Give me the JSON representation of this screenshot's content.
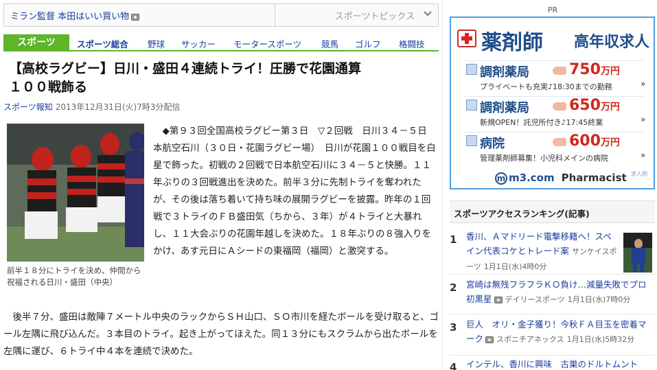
{
  "topbar": {
    "ticker": "ミラン監督 本田はいい買い物",
    "topics_label": "スポーツトピックス"
  },
  "nav": {
    "brand": "スポーツ",
    "items": [
      "スポーツ総合",
      "野球",
      "サッカー",
      "モータースポーツ",
      "競馬",
      "ゴルフ",
      "格闘技"
    ]
  },
  "article": {
    "headline_line1": "【高校ラグビー】日川・盛田４連続トライ！圧勝で花園通算",
    "headline_line2": "１００戦飾る",
    "source": "スポーツ報知",
    "date": "2013年12月31日(火)7時3分配信",
    "photo_caption": "前半１８分にトライを決め、仲間から祝福される日川・盛田（中央）",
    "lead": "◆第９３回全国高校ラグビー第３日　▽２回戦　日川３４－５日本航空石川（３０日・花園ラグビー場）　日川が花園１００戦目を白星で飾った。初戦の２回戦で日本航空石川に３４－５と快勝。１１年ぶりの３回戦進出を決めた。前半３分に先制トライを奪われたが、その後は落ち着いて持ち味の展開ラグビーを披露。昨年の１回戦で３トライのＦＢ盛田気（ちから、３年）が４トライと大暴れし、１１大会ぶりの花園年越しを決めた。１８年ぶりの８強入りをかけ、あす元日にＡシードの東福岡（福岡）と激突する。",
    "body": "後半７分、盛田は敵陣７メートル中央のラックからＳＨ山口、ＳＯ市川を経たボールを受け取ると、ゴール左隅に飛び込んだ。３本目のトライ。起き上がってほえた。同１３分にもスクラムから出たボールを左隅に運び、６トライ中４本を連続で決めた。"
  },
  "ad": {
    "pr": "PR",
    "title": "薬剤師",
    "title2": "高年収求人",
    "offers": [
      {
        "kind": "調剤薬局",
        "pay": "750",
        "unit": "万円",
        "note": "プライベートも充実♪18:30までの勤務",
        "more": "»"
      },
      {
        "kind": "調剤薬局",
        "pay": "650",
        "unit": "万円",
        "note": "新規OPEN！託児所付き♪17:45終業",
        "more": "»"
      },
      {
        "kind": "病院",
        "pay": "600",
        "unit": "万円",
        "note": "管理薬剤師募集！小児科メインの病院",
        "more": "»"
      }
    ],
    "logo": "m3.com",
    "logo_sub": "Pharmacist",
    "small": "求人例"
  },
  "ranking": {
    "title": "スポーツアクセスランキング(記事)",
    "items": [
      {
        "no": "1",
        "title": "香川、Ａマドリード電撃移籍へ！スペイン代表コケとトレード案",
        "source": "サンケイスポーツ",
        "date": "1月1日(水)4時0分"
      },
      {
        "no": "2",
        "title": "宮崎は無残フラフラＫＯ負け…減量失敗でプロ初黒星",
        "source": "デイリースポーツ",
        "date": "1月1日(水)7時0分"
      },
      {
        "no": "3",
        "title": "巨人　オリ・金子獲り！今秋ＦＡ目玉を密着マーク",
        "source": "スポニチアネックス",
        "date": "1月1日(水)5時32分"
      },
      {
        "no": "4",
        "title": "インテル、香川に興味　古巣のドルトムント",
        "source": "",
        "date": ""
      }
    ]
  },
  "colors": {
    "link": "#1a3d9e",
    "brand_green": "#5db52a",
    "ad_border": "#4f9fe0",
    "ad_price": "#d0281c"
  },
  "icons": [
    "camera-icon",
    "chevron-down-icon",
    "medical-cross-icon"
  ]
}
